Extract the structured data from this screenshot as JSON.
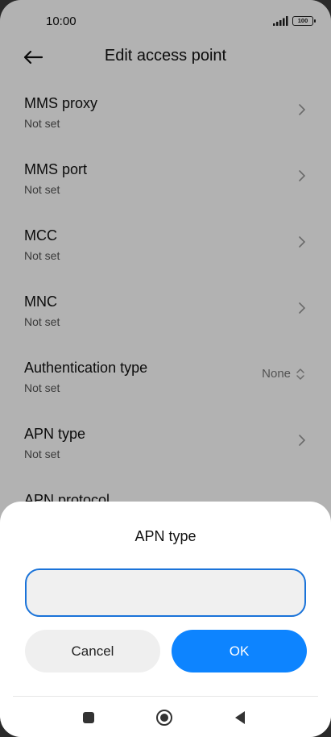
{
  "status_bar": {
    "time": "10:00",
    "battery": "100"
  },
  "header": {
    "title": "Edit access point"
  },
  "settings": [
    {
      "title": "MMS proxy",
      "value": "Not set"
    },
    {
      "title": "MMS port",
      "value": "Not set"
    },
    {
      "title": "MCC",
      "value": "Not set"
    },
    {
      "title": "MNC",
      "value": "Not set"
    },
    {
      "title": "Authentication type",
      "value": "Not set",
      "selected": "None"
    },
    {
      "title": "APN type",
      "value": "Not set"
    },
    {
      "title": "APN protocol",
      "value": ""
    }
  ],
  "dialog": {
    "title": "APN type",
    "input_value": "",
    "cancel_label": "Cancel",
    "ok_label": "OK"
  },
  "colors": {
    "accent": "#0d84ff",
    "input_border": "#1a73d9"
  },
  "icons": [
    "back-arrow-icon",
    "chevron-right-icon",
    "up-down-icon",
    "recents-icon",
    "home-icon",
    "back-icon"
  ]
}
